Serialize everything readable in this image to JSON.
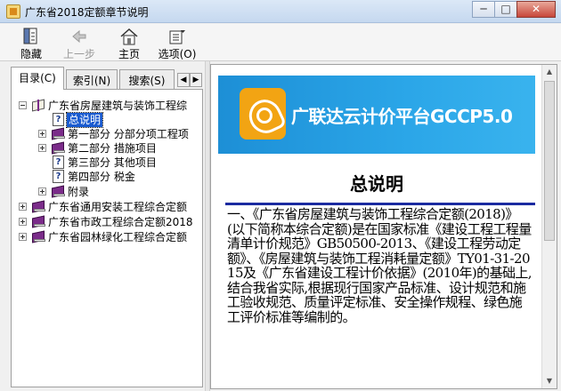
{
  "window": {
    "title": "广东省2018定额章节说明",
    "minimize_glyph": "─",
    "maximize_glyph": "□",
    "close_glyph": "✕"
  },
  "toolbar": {
    "hide_label": "隐藏",
    "back_label": "上一步",
    "home_label": "主页",
    "options_label": "选项(O)"
  },
  "tabs": {
    "contents": "目录(C)",
    "index": "索引(N)",
    "search": "搜索(S)",
    "scroll_left": "◀",
    "scroll_right": "▶"
  },
  "tree": {
    "root": "广东省房屋建筑与装饰工程综",
    "overview": "总说明",
    "part1": "第一部分  分部分项工程项",
    "part2": "第二部分  措施项目",
    "part3": "第三部分  其他项目",
    "part4": "第四部分  税金",
    "appendix": "附录",
    "install": "广东省通用安装工程综合定额",
    "municipal": "广东省市政工程综合定额2018",
    "landscape": "广东省园林绿化工程综合定额"
  },
  "content": {
    "banner_title": "广联达云计价平台GCCP5.0",
    "doc_title": "总说明",
    "paragraph": "一、《广东省房屋建筑与装饰工程综合定额(2018)》(以下简称本综合定额)是在国家标准《建设工程工程量清单计价规范》GB50500-2013、《建设工程劳动定额》、《房屋建筑与装饰工程消耗量定额》TY01-31-2015及《广东省建设工程计价依据》(2010年)的基础上,结合我省实际,根据现行国家产品标准、设计规范和施工验收规范、质量评定标准、安全操作规程、绿色施工评价标准等编制的。"
  }
}
